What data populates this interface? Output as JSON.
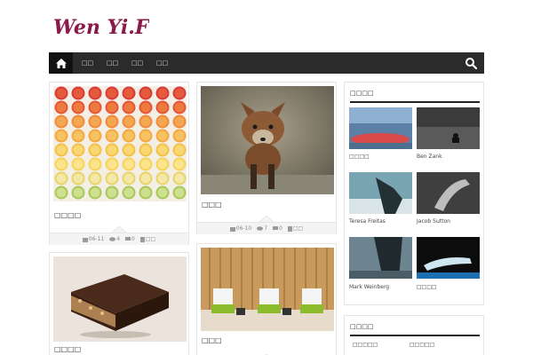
{
  "site": {
    "logo_text": "Wen Yi.Fr"
  },
  "nav": {
    "items": [
      "□□",
      "□□",
      "□□",
      "□□"
    ]
  },
  "posts": [
    {
      "title": "□□□□",
      "date": "06-11",
      "views": "4",
      "comments": "0",
      "more": "□□"
    },
    {
      "title": "□□□",
      "date": "06-10",
      "views": "7",
      "comments": "0",
      "more": "□□"
    },
    {
      "title": "□□□□"
    },
    {
      "title": "□□□"
    }
  ],
  "sidebar": {
    "gallery_title": "□□□□",
    "gallery": [
      {
        "caption": "□□□□"
      },
      {
        "caption": "Ben Zank"
      },
      {
        "caption": "Teresa Freitas"
      },
      {
        "caption": "Jacob Sutton"
      },
      {
        "caption": "Mark Weinberg"
      },
      {
        "caption": "□□□□"
      }
    ],
    "second_title": "□□□□",
    "second_items": [
      "□□□□□",
      "□□□□□"
    ]
  },
  "colors": {
    "nav_bg": "#2b2b2b",
    "nav_home_bg": "#111111",
    "logo": "#8b1a4a"
  },
  "icons": {
    "home": "home-icon",
    "search": "search-icon",
    "calendar": "calendar-icon",
    "eye": "eye-icon",
    "comment": "comment-icon",
    "more": "more-icon"
  }
}
